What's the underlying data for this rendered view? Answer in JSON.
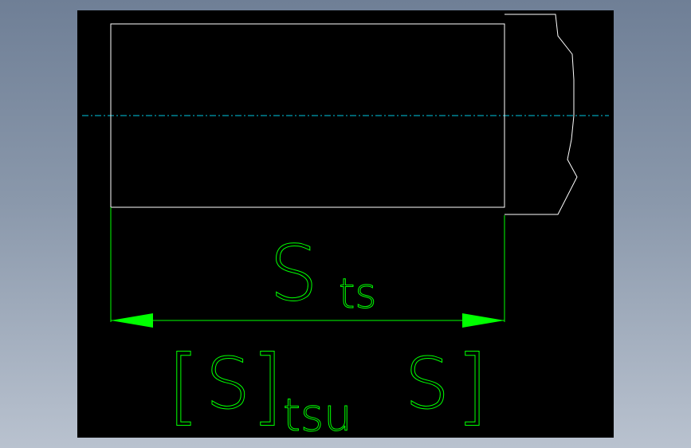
{
  "colors": {
    "background": "#000000",
    "outline": "#ffffff",
    "dimension": "#00ff00",
    "centerline": "#00c8e0",
    "frame": "#8a98ab"
  },
  "dimension": {
    "label_main": "S",
    "label_main_sub": "ts",
    "tol_open": "[",
    "tol_S1": "S",
    "tol_close_mid": "]",
    "tol_sub": "tsu",
    "tol_S2": "S",
    "tol_close_end": "]"
  }
}
